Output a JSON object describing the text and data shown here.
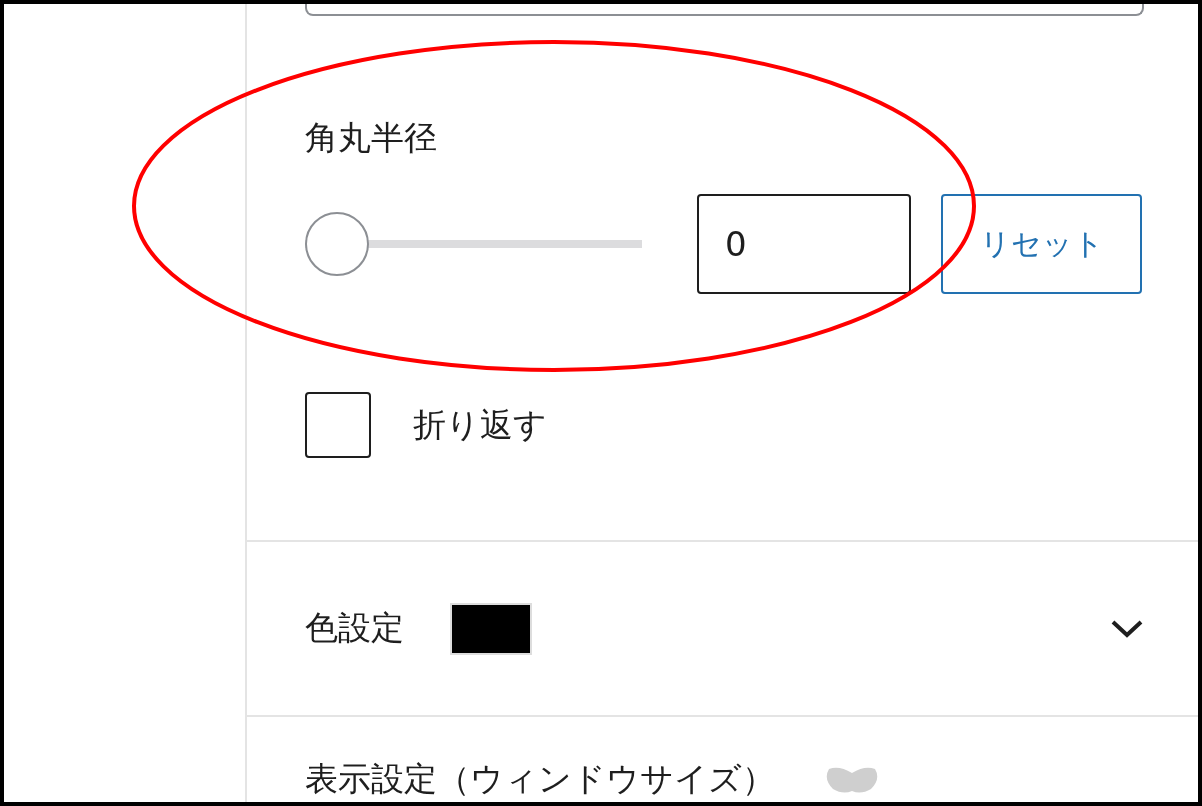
{
  "annotation": {
    "kind": "ellipse",
    "color": "#ff0000"
  },
  "radius": {
    "label": "角丸半径",
    "slider": {
      "level": 0
    },
    "value": "0",
    "reset_button": "リセット"
  },
  "wrap": {
    "label": "折り返す",
    "checked": false
  },
  "color_settings": {
    "title": "色設定",
    "color": "#000000",
    "expanded": false
  },
  "display_settings": {
    "title": "表示設定（ウィンドウサイズ）"
  }
}
